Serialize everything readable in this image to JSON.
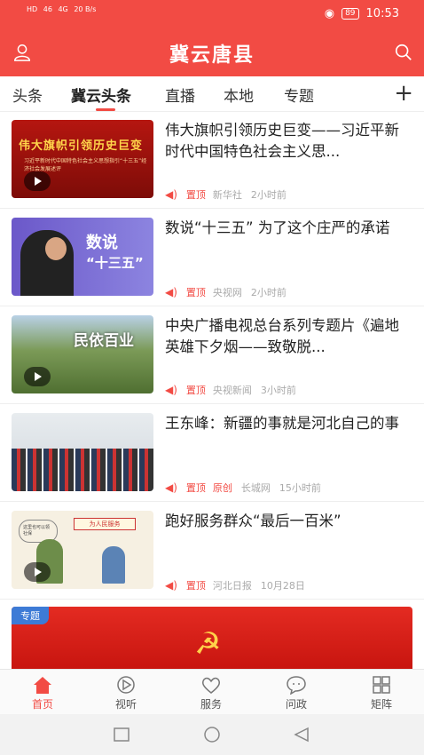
{
  "status": {
    "left_lines": [
      "HD",
      "HD"
    ],
    "signal1": "46",
    "signal2": "4G",
    "speed": "20 B/s",
    "battery": "89",
    "time": "10:53"
  },
  "header": {
    "title": "冀云唐县"
  },
  "tabs": [
    {
      "label": "头条"
    },
    {
      "label": "冀云头条"
    },
    {
      "label": "直播"
    },
    {
      "label": "本地"
    },
    {
      "label": "专题"
    }
  ],
  "tab_add": "+",
  "news": [
    {
      "headline": "伟大旗帜引领历史巨变——习近平新时代中国特色社会主义思...",
      "pin": "置顶",
      "source": "新华社",
      "time": "2小时前",
      "thumb_big": "伟大旗帜引领历史巨变",
      "thumb_sub": "习近平新时代中国特色社会主义思想指引“十三五”经济社会发展述评"
    },
    {
      "headline": "数说“十三五” 为了这个庄严的承诺",
      "pin": "置顶",
      "source": "央视网",
      "time": "2小时前",
      "thumb_big": "数说",
      "thumb_big2": "“十三五”"
    },
    {
      "headline": "中央广播电视总台系列专题片《遍地英雄下夕烟——致敬脱...",
      "pin": "置顶",
      "source": "央视新闻",
      "time": "3小时前",
      "thumb_big": "民依百业"
    },
    {
      "headline": "王东峰：新疆的事就是河北自己的事",
      "pin": "置顶",
      "original": "原创",
      "source": "长城网",
      "time": "15小时前"
    },
    {
      "headline": "跑好服务群众“最后一百米”",
      "pin": "置顶",
      "source": "河北日报",
      "time": "10月28日",
      "thumb_bubble": "这里也可以领社保",
      "thumb_sign": "为人民服务"
    }
  ],
  "banner": {
    "tag": "专题"
  },
  "nav": [
    {
      "label": "首页",
      "icon": "home-icon"
    },
    {
      "label": "视听",
      "icon": "play-circle-icon"
    },
    {
      "label": "服务",
      "icon": "heart-hands-icon"
    },
    {
      "label": "问政",
      "icon": "chat-bubble-icon"
    },
    {
      "label": "矩阵",
      "icon": "grid-icon"
    }
  ],
  "colors": {
    "brand": "#f24b44",
    "tag_blue": "#3d7bd6"
  }
}
